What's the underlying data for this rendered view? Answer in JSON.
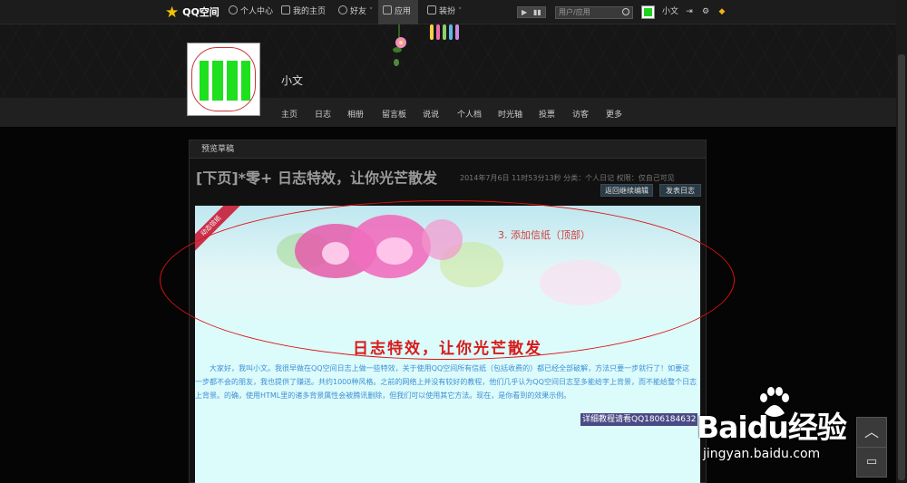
{
  "topbar": {
    "logo": "QQ空间",
    "items": [
      "个人中心",
      "我的主页",
      "好友",
      "应用",
      "装扮"
    ],
    "search_placeholder": "用户/应用",
    "username": "小文"
  },
  "header": {
    "nickname": "小文",
    "nav": [
      "主页",
      "日志",
      "相册",
      "留言板",
      "说说",
      "个人档",
      "时光轴",
      "投票",
      "访客",
      "更多"
    ]
  },
  "panel": {
    "head": "预览草稿",
    "title": "[下页]*零+   日志特效，让你光芒散发",
    "meta": "2014年7月6日 11时53分13秒  分类：个人日记  权限：仅自己可见",
    "btn_back": "返回继续编辑",
    "btn_publish": "发表日志"
  },
  "letter": {
    "ribbon": "动态信纸",
    "step_label": "3. 添加信纸（顶部）",
    "title": "日志特效，让你光芒散发",
    "body": "大家好，我叫小文。我很早做在QQ空间日志上做一些特效，关于使用QQ空间所有信纸（包括收费的）都已经全部破解，方法只要一步就行了！如要这一步都不会的朋友，我也提供了赚送。共约1000种风格。之前的网络上并没有较好的教程，他们几乎认为QQ空间日志至多能给字上背景，而不能给整个日志上背景。的确，使用HTML里的诸多背景属性会被腾讯删除，但我们可以使用其它方法。现在，是你看到的效果示例。",
    "contact": "详细教程请看QQ1806184632"
  },
  "watermark": {
    "brand": "Baidu经验",
    "url": "jingyan.baidu.com"
  },
  "side_buttons": {
    "top": "︿",
    "feedback": "▭"
  },
  "colors": {
    "accent_red": "#d81a1a",
    "annotation": "#e01010",
    "body_text": "#3f8fd6",
    "letter_bg": "#dcfbfb"
  },
  "icons": [
    "star-icon",
    "person-icon",
    "home-icon",
    "friends-icon",
    "apps-icon",
    "outfit-icon",
    "play-icon",
    "search-icon",
    "logout-icon",
    "gear-icon",
    "diamond-icon"
  ]
}
